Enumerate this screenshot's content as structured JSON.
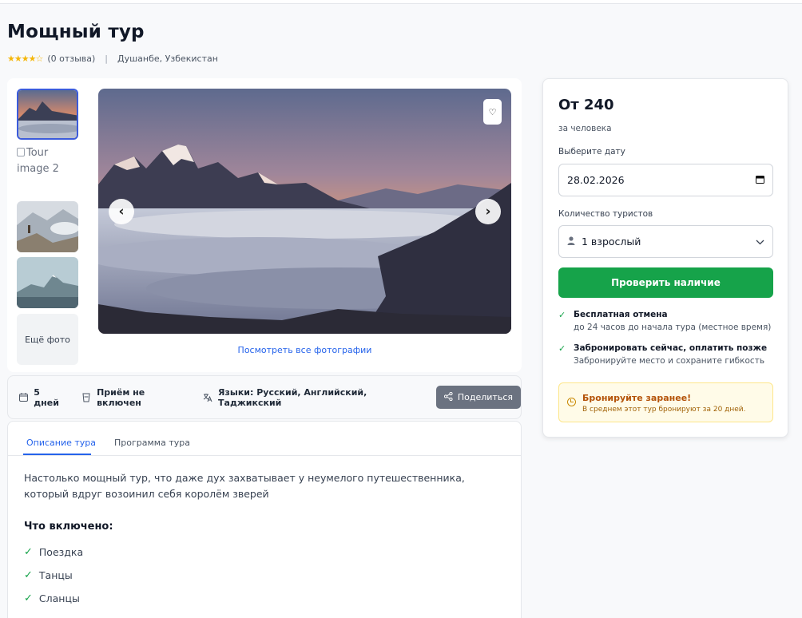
{
  "tour": {
    "title": "Мощный тур",
    "rating_stars": "★★★★☆",
    "reviews": "(0 отзыва)",
    "separator": "|",
    "location": "Душанбе, Узбекистан"
  },
  "gallery": {
    "broken_alt": "Tour image 2",
    "more_photos": "Ещё фото",
    "see_all": "Посмотреть все фотографии",
    "heart_glyph": "♡",
    "prev_glyph": "‹",
    "next_glyph": "›"
  },
  "info": {
    "duration": "5 дней",
    "meals": "Приём не включен",
    "languages": "Языки: Русский, Английский, Таджикский",
    "share": "Поделиться"
  },
  "tabs": [
    {
      "label": "Описание тура",
      "active": true
    },
    {
      "label": "Программа тура",
      "active": false
    }
  ],
  "description": {
    "text": "Настолько мощный тур, что даже дух захватывает у неумелого путешественника, который вдруг возоинил себя королём зверей",
    "included_title": "Что включено:",
    "included": [
      "Поездка",
      "Танцы",
      "Сланцы"
    ]
  },
  "booking": {
    "price": "От 240",
    "per_person": "за человека",
    "date_label": "Выберите дату",
    "date_value": "28.02.2026",
    "tourists_label": "Количество туристов",
    "tourists_value": "1 взрослый",
    "check_button": "Проверить наличие",
    "features": [
      {
        "title": "Бесплатная отмена",
        "subtitle": "до 24 часов до начала тура (местное время)"
      },
      {
        "title": "Забронировать сейчас, оплатить позже",
        "subtitle": "Забронируйте место и сохраните гибкость"
      }
    ],
    "notice_title": "Бронируйте заранее!",
    "notice_text": "В среднем этот тур бронируют за 20 дней."
  },
  "colors": {
    "accent_blue": "#2563eb",
    "primary_green": "#16a34a",
    "star_yellow": "#f5b70a",
    "notice_bg": "#fffbe8"
  }
}
